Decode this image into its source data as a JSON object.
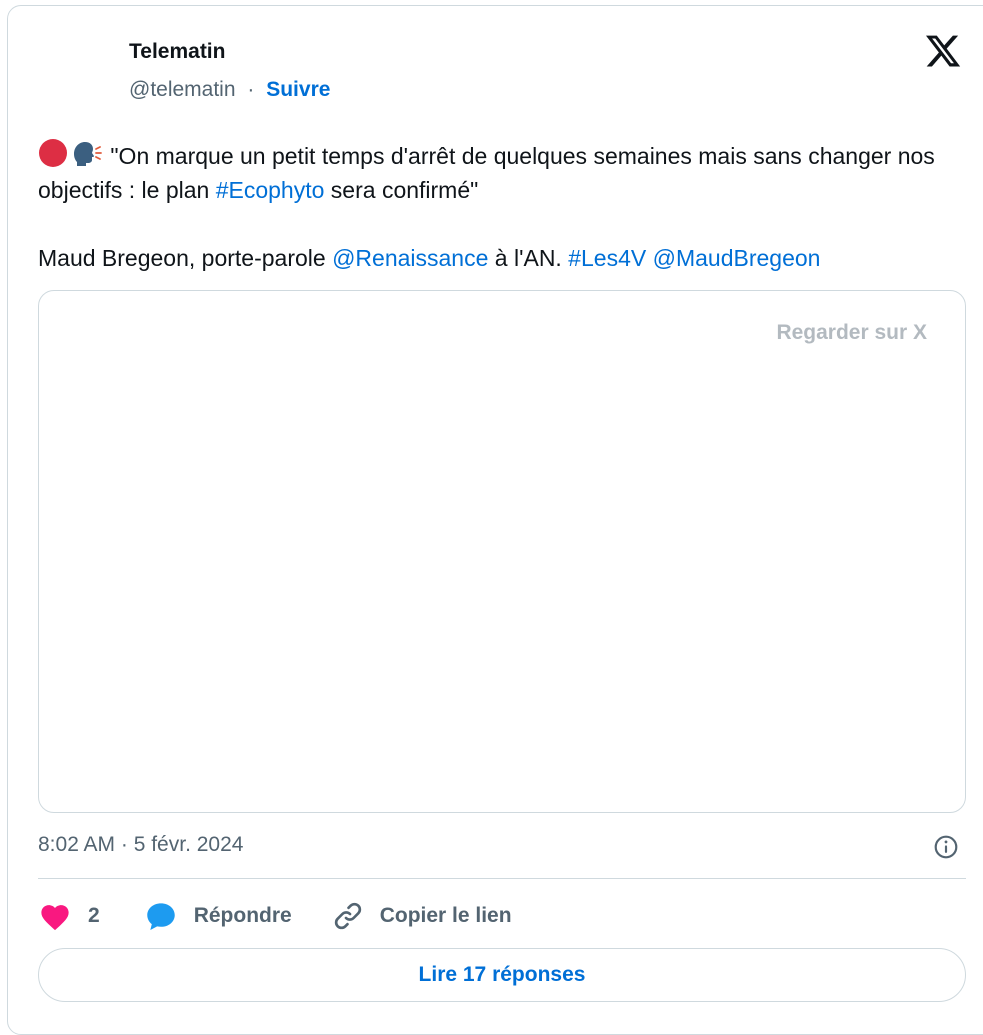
{
  "author": {
    "name": "Telematin",
    "handle": "@telematin",
    "separator": "·",
    "follow_label": "Suivre"
  },
  "tweet": {
    "line1_text": " \"On marque un petit temps d'arrêt de quelques semaines mais sans changer nos objectifs : le plan ",
    "hashtag_ecophyto": "#Ecophyto",
    "line1_end": " sera confirmé\"",
    "line2_start": "Maud Bregeon, porte-parole ",
    "mention_renaissance": "@Renaissance",
    "line2_mid": " à l'AN. ",
    "hashtag_les4v": "#Les4V",
    "line2_space": " ",
    "mention_maud": "@MaudBregeon"
  },
  "media": {
    "watch_label": "Regarder sur X"
  },
  "meta": {
    "timestamp": "8:02 AM · 5 févr. 2024"
  },
  "actions": {
    "like_count": "2",
    "reply_label": "Répondre",
    "copy_label": "Copier le lien"
  },
  "footer": {
    "read_replies_label": "Lire 17 réponses"
  },
  "colors": {
    "link": "#006fd6",
    "muted": "#536471",
    "like": "#f91880",
    "reply": "#1d9bf0",
    "border": "#cfd9de"
  },
  "icons": {
    "logo": "x-logo-icon",
    "live": "red-circle-icon",
    "speaking": "speaking-head-icon",
    "info": "info-icon",
    "like": "heart-icon",
    "reply": "speech-bubble-icon",
    "copy": "link-icon"
  }
}
